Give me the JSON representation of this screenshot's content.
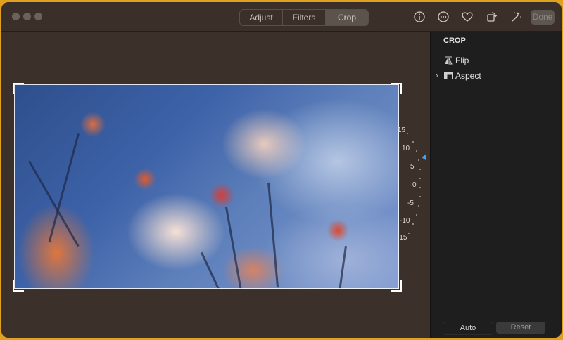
{
  "toolbar": {
    "tabs": [
      {
        "label": "Adjust",
        "active": false
      },
      {
        "label": "Filters",
        "active": false
      },
      {
        "label": "Crop",
        "active": true
      }
    ],
    "icons": [
      "info-icon",
      "more-icon",
      "heart-icon",
      "rotate-icon",
      "magic-wand-icon"
    ],
    "done_label": "Done"
  },
  "dial": {
    "labels": [
      "15",
      "10",
      "5",
      "0",
      "-5",
      "-10",
      "-15"
    ],
    "pointer_color": "#3da1ff"
  },
  "sidebar": {
    "title": "CROP",
    "items": [
      {
        "label": "Flip",
        "icon": "flip-icon"
      },
      {
        "label": "Aspect",
        "icon": "aspect-icon"
      }
    ],
    "auto_label": "Auto",
    "reset_label": "Reset"
  },
  "colors": {
    "window_bg": "#3b302a",
    "sidebar_bg": "#1e1e1e",
    "accent": "#3da1ff"
  }
}
